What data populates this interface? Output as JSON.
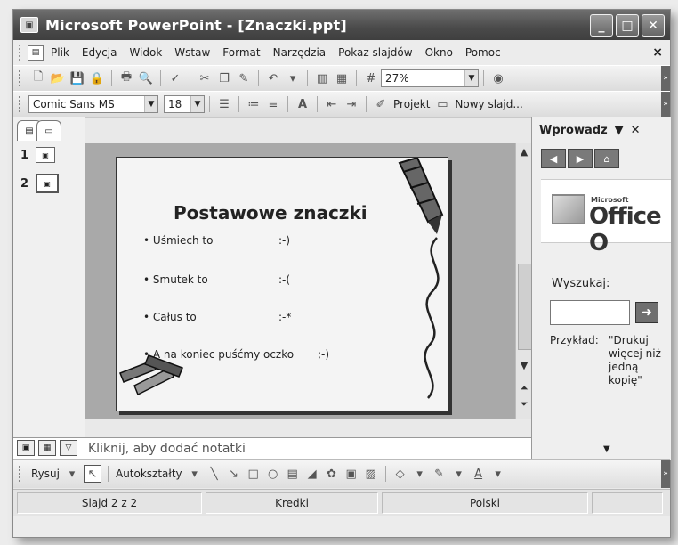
{
  "window": {
    "title": "Microsoft PowerPoint - [Znaczki.ppt]"
  },
  "menu": {
    "items": [
      "Plik",
      "Edycja",
      "Widok",
      "Wstaw",
      "Format",
      "Narzędzia",
      "Pokaz slajdów",
      "Okno",
      "Pomoc"
    ],
    "close": "×"
  },
  "standard_toolbar": {
    "zoom": "27%"
  },
  "format_toolbar": {
    "font": "Comic Sans MS",
    "size": "18",
    "design": "Projekt",
    "new_slide": "Nowy slajd..."
  },
  "slides_pane": {
    "items": [
      {
        "number": "1"
      },
      {
        "number": "2"
      }
    ]
  },
  "slide": {
    "title": "Postawowe znaczki",
    "bullets": [
      {
        "text": "Uśmiech to",
        "value": ":-)"
      },
      {
        "text": "Smutek to",
        "value": ":-("
      },
      {
        "text": "Całus to",
        "value": ":-*"
      },
      {
        "text": "A na koniec puśćmy oczko",
        "value": ";-)"
      }
    ]
  },
  "taskpane": {
    "title": "Wprowadz",
    "logo_small": "Microsoft",
    "logo": "Office O",
    "search_label": "Wyszukaj:",
    "example_label": "Przykład:",
    "example_value": "\"Drukuj więcej niż jedną kopię\""
  },
  "notes": {
    "placeholder": "Kliknij, aby dodać notatki"
  },
  "drawing_toolbar": {
    "draw": "Rysuj",
    "autoshapes": "Autokształty"
  },
  "status": {
    "slide": "Slajd 2 z 2",
    "design": "Kredki",
    "language": "Polski"
  }
}
